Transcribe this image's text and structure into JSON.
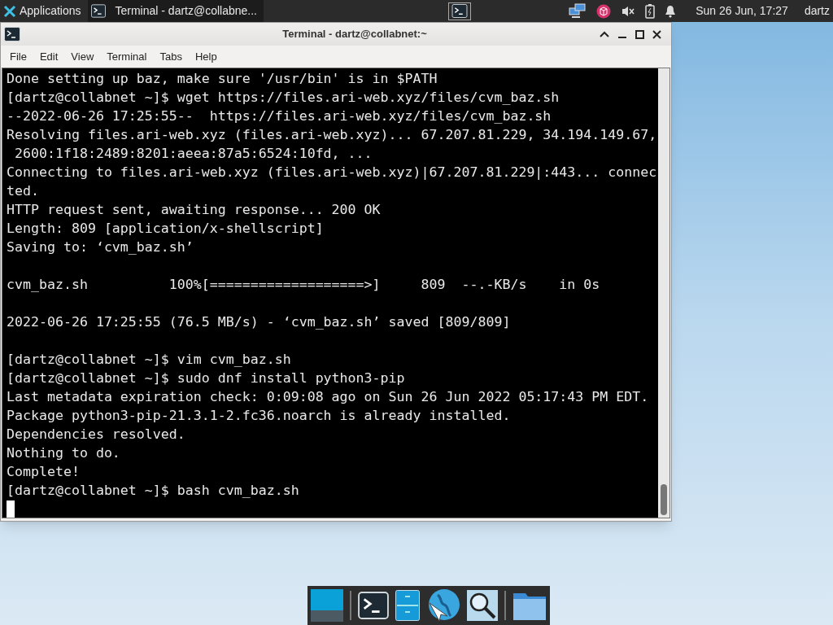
{
  "panel": {
    "applications": "Applications",
    "task": "Terminal - dartz@collabne...",
    "clock": "Sun 26 Jun, 17:27",
    "user": "dartz"
  },
  "window": {
    "title": "Terminal - dartz@collabnet:~",
    "menu": [
      "File",
      "Edit",
      "View",
      "Terminal",
      "Tabs",
      "Help"
    ]
  },
  "terminal": {
    "blocks": [
      [
        "Done setting up baz, make sure '/usr/bin' is in $PATH",
        "[dartz@collabnet ~]$ wget https://files.ari-web.xyz/files/cvm_baz.sh",
        "--2022-06-26 17:25:55--  https://files.ari-web.xyz/files/cvm_baz.sh",
        "Resolving files.ari-web.xyz (files.ari-web.xyz)... 67.207.81.229, 34.194.149.67,",
        " 2600:1f18:2489:8201:aeea:87a5:6524:10fd, ...",
        "Connecting to files.ari-web.xyz (files.ari-web.xyz)|67.207.81.229|:443... connec",
        "ted.",
        "HTTP request sent, awaiting response... 200 OK",
        "Length: 809 [application/x-shellscript]",
        "Saving to: ‘cvm_baz.sh’"
      ],
      [
        "cvm_baz.sh          100%[===================>]     809  --.-KB/s    in 0s"
      ],
      [
        "2022-06-26 17:25:55 (76.5 MB/s) - ‘cvm_baz.sh’ saved [809/809]"
      ],
      [
        "[dartz@collabnet ~]$ vim cvm_baz.sh",
        "[dartz@collabnet ~]$ sudo dnf install python3-pip",
        "Last metadata expiration check: 0:09:08 ago on Sun 26 Jun 2022 05:17:43 PM EDT.",
        "Package python3-pip-21.3.1-2.fc36.noarch is already installed.",
        "Dependencies resolved.",
        "Nothing to do.",
        "Complete!",
        "[dartz@collabnet ~]$ bash cvm_baz.sh"
      ]
    ],
    "cursor_visible": true
  }
}
